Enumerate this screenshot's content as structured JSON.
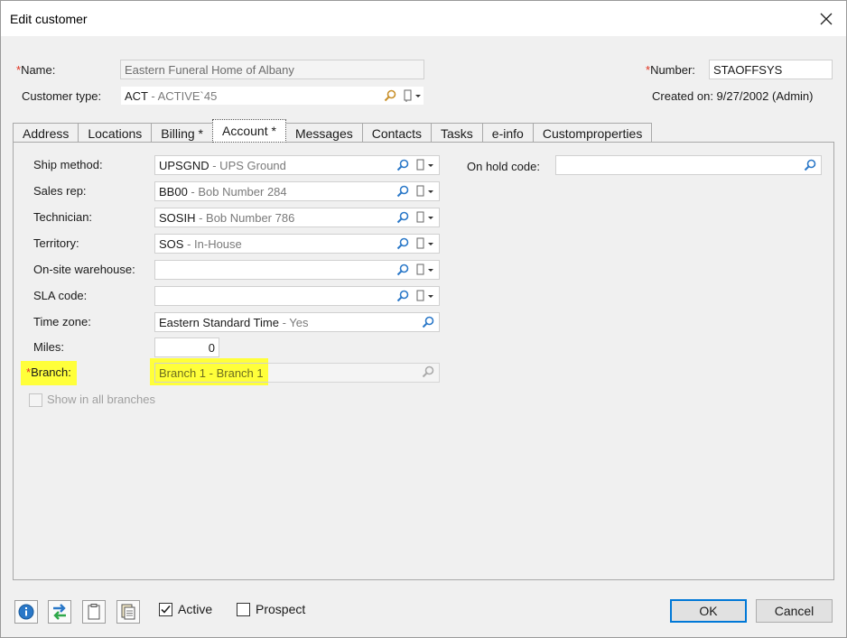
{
  "window": {
    "title": "Edit customer",
    "close_icon": "close-icon"
  },
  "header": {
    "name_label": "Name:",
    "name_value": "Eastern Funeral Home of Albany",
    "customer_type_label": "Customer type:",
    "customer_type_code": "ACT",
    "customer_type_desc": " - ACTIVE`45",
    "number_label": "Number:",
    "number_value": "STAOFFSYS",
    "created_on": "Created on: 9/27/2002 (Admin)"
  },
  "tabs": [
    {
      "label": "Address"
    },
    {
      "label": "Locations"
    },
    {
      "label": "Billing *"
    },
    {
      "label": "Account *"
    },
    {
      "label": "Messages"
    },
    {
      "label": "Contacts"
    },
    {
      "label": "Tasks"
    },
    {
      "label": "e-info"
    },
    {
      "label": "Customproperties"
    }
  ],
  "account": {
    "ship_method_label": "Ship method:",
    "ship_method_code": "UPSGND",
    "ship_method_desc": " - UPS Ground",
    "sales_rep_label": "Sales rep:",
    "sales_rep_code": "BB00",
    "sales_rep_desc": " - Bob Number 284",
    "technician_label": "Technician:",
    "technician_code": "SOSIH",
    "technician_desc": " - Bob Number 786",
    "territory_label": "Territory:",
    "territory_code": "SOS",
    "territory_desc": " - In-House",
    "onsite_label": "On-site warehouse:",
    "onsite_value": "",
    "sla_label": "SLA code:",
    "sla_value": "",
    "timezone_label": "Time zone:",
    "timezone_code": "Eastern Standard Time",
    "timezone_desc": " - Yes",
    "miles_label": "Miles:",
    "miles_value": "0",
    "branch_label": "Branch:",
    "branch_value": "Branch 1 - Branch 1",
    "show_all_branches_label": "Show in all branches",
    "on_hold_label": "On hold code:",
    "on_hold_value": ""
  },
  "footer": {
    "active_label": "Active",
    "active_checked": true,
    "prospect_label": "Prospect",
    "prospect_checked": false,
    "ok_label": "OK",
    "cancel_label": "Cancel"
  },
  "colors": {
    "highlight": "#ffff3a",
    "required": "#e0301e",
    "ok_border": "#0078d7",
    "info_icon": "#2a78c8"
  }
}
